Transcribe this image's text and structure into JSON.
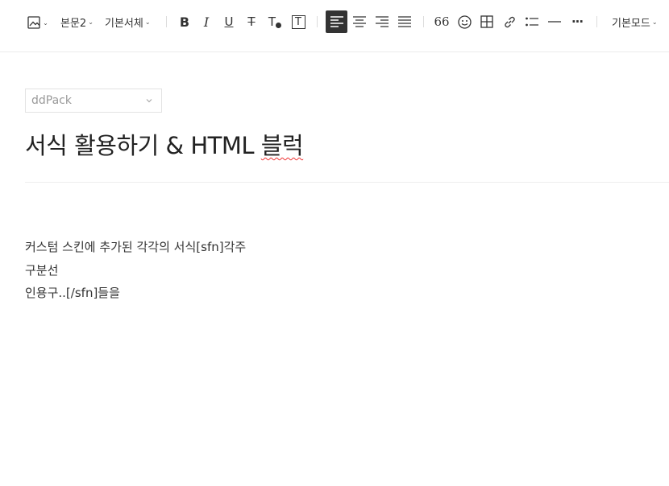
{
  "toolbar": {
    "image_button": {
      "icon": "image-icon"
    },
    "paragraph_style": "본문2",
    "font_family": "기본서체",
    "bold": {
      "icon": "bold-icon",
      "glyph": "B"
    },
    "italic": {
      "icon": "italic-icon",
      "glyph": "I"
    },
    "underline": {
      "icon": "underline-icon",
      "glyph": "U"
    },
    "strikethrough": {
      "icon": "strikethrough-icon",
      "glyph": "T"
    },
    "text_color": {
      "icon": "text-color-icon",
      "glyph": "T"
    },
    "background_color": {
      "icon": "text-background-icon",
      "glyph": "T"
    },
    "align_left": {
      "icon": "align-left-icon",
      "active": true
    },
    "align_center": {
      "icon": "align-center-icon"
    },
    "align_right": {
      "icon": "align-right-icon"
    },
    "align_justify": {
      "icon": "align-justify-icon"
    },
    "quote": {
      "icon": "quote-icon",
      "glyph": "66"
    },
    "emoticon": {
      "icon": "emoticon-icon"
    },
    "table": {
      "icon": "table-icon"
    },
    "link": {
      "icon": "link-icon"
    },
    "list": {
      "icon": "list-icon"
    },
    "divider": {
      "icon": "horizontal-rule-icon"
    },
    "more": {
      "icon": "more-icon",
      "glyph": "···"
    },
    "mode": "기본모드"
  },
  "editor": {
    "category": "ddPack",
    "title_main": "서식 활용하기 & HTML ",
    "title_misspelled": "블럭",
    "body_lines": [
      "커스텀 스킨에 추가된 각각의 서식[sfn]각주",
      "구분선",
      "인용구..[/sfn]들을"
    ]
  },
  "colors": {
    "active_button_bg": "#333333",
    "spellcheck_underline": "#ee3333",
    "divider": "#ebebeb"
  }
}
